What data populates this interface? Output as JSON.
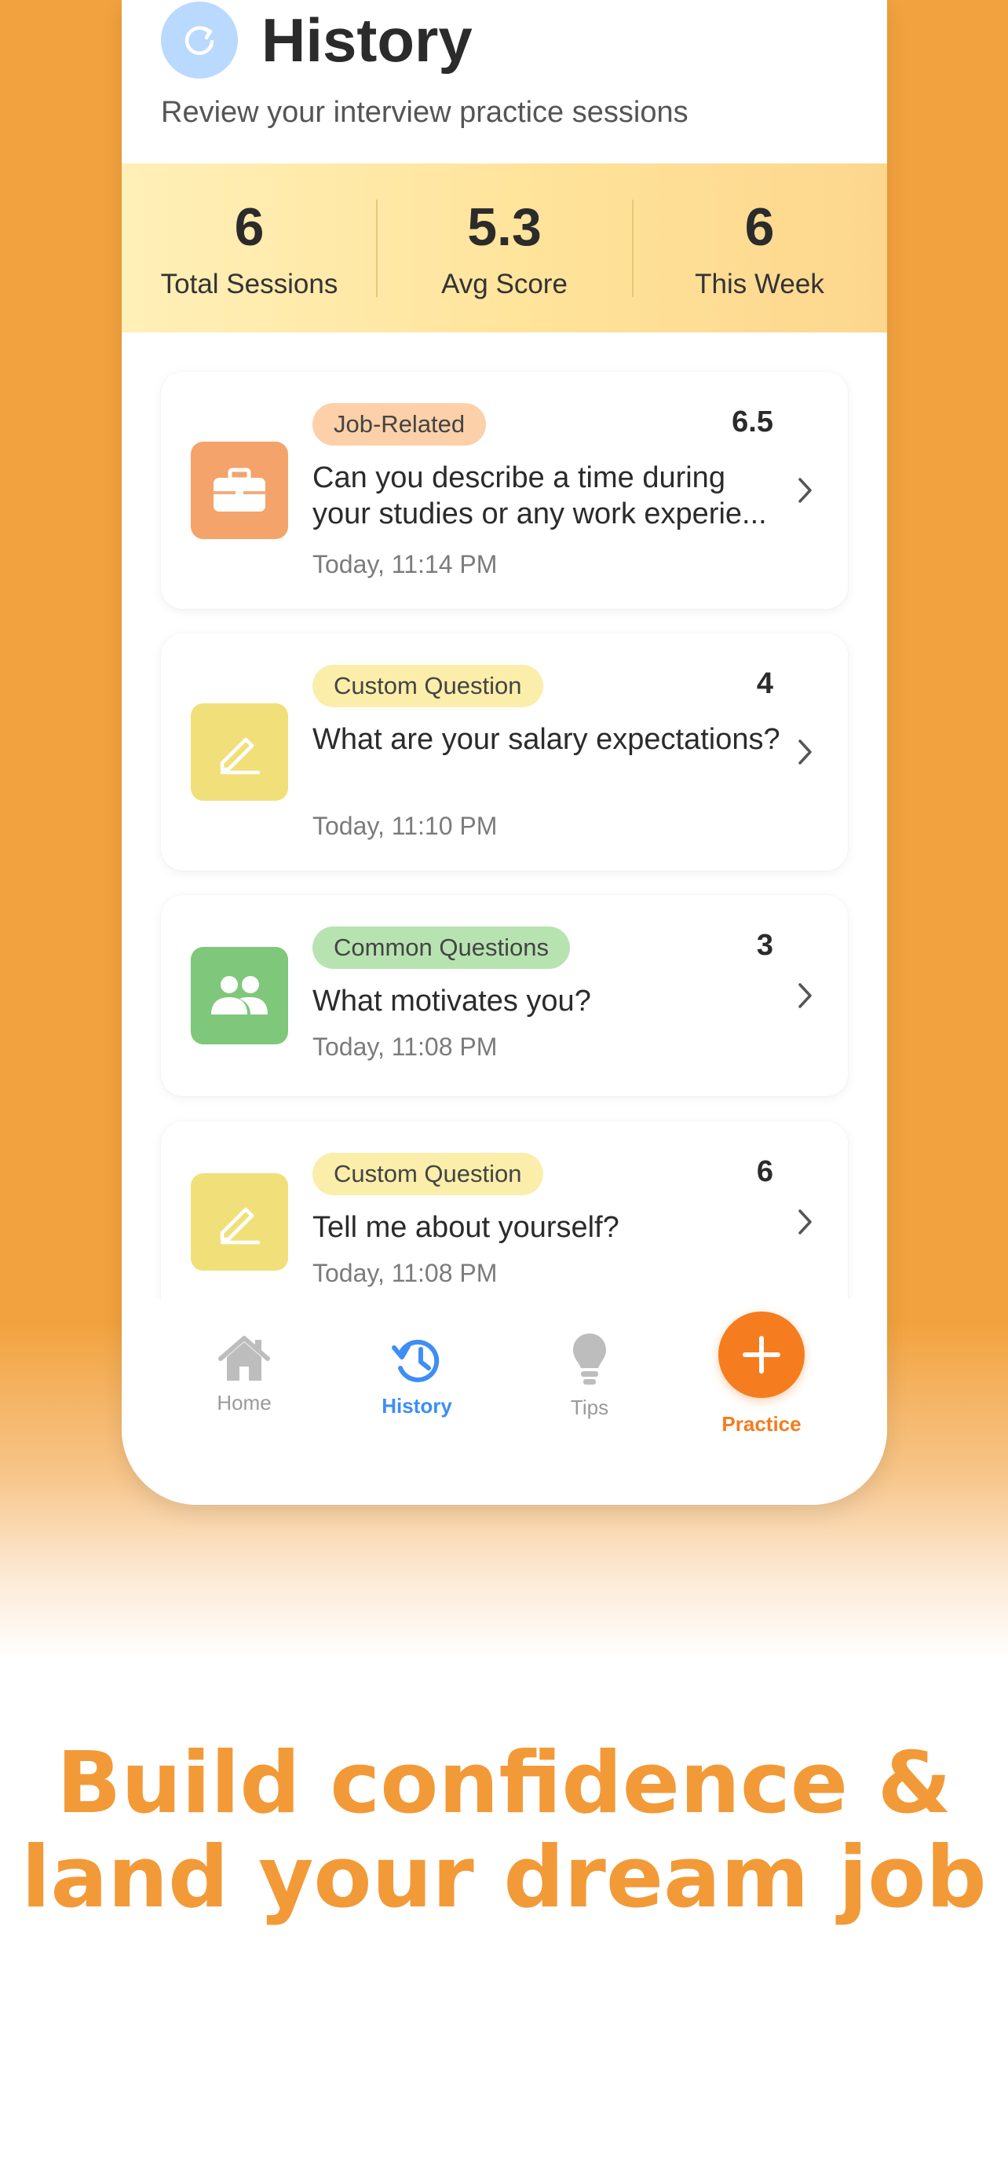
{
  "header": {
    "icon": "refresh-icon",
    "title": "History",
    "subtitle": "Review your interview practice sessions"
  },
  "stats": [
    {
      "value": "6",
      "label": "Total Sessions"
    },
    {
      "value": "5.3",
      "label": "Avg Score"
    },
    {
      "value": "6",
      "label": "This Week"
    }
  ],
  "sessions": [
    {
      "category": "Job-Related",
      "icon": "briefcase-icon",
      "score": "6.5",
      "question": "Can you describe a time during your studies or any work experie...",
      "date": "Today, 11:14 PM",
      "color": "#f4a36a",
      "badge_color": "#fcd0a8"
    },
    {
      "category": "Custom Question",
      "icon": "pencil-icon",
      "score": "4",
      "question": "What are your salary expectations?",
      "date": "Today, 11:10 PM",
      "color": "#f1e07a",
      "badge_color": "#fbeeaa"
    },
    {
      "category": "Common Questions",
      "icon": "people-icon",
      "score": "3",
      "question": "What motivates you?",
      "date": "Today, 11:08 PM",
      "color": "#7fc77a",
      "badge_color": "#b7e3b1"
    },
    {
      "category": "Custom Question",
      "icon": "pencil-icon",
      "score": "6",
      "question": "Tell me about yourself?",
      "date": "Today, 11:08 PM",
      "color": "#f1e07a",
      "badge_color": "#fbeeaa"
    }
  ],
  "tabs": [
    {
      "label": "Home",
      "icon": "home-icon",
      "active": false
    },
    {
      "label": "History",
      "icon": "history-icon",
      "active": true
    },
    {
      "label": "Tips",
      "icon": "lightbulb-icon",
      "active": false
    },
    {
      "label": "Practice",
      "icon": "plus-icon",
      "active": false
    }
  ],
  "colors": {
    "background": "#f2a23e",
    "accent_blue": "#3d8ef5",
    "accent_orange": "#f57c1f",
    "tagline": "#f29a38"
  },
  "tagline": {
    "line1": "Build confidence &",
    "line2": "land your dream job"
  }
}
